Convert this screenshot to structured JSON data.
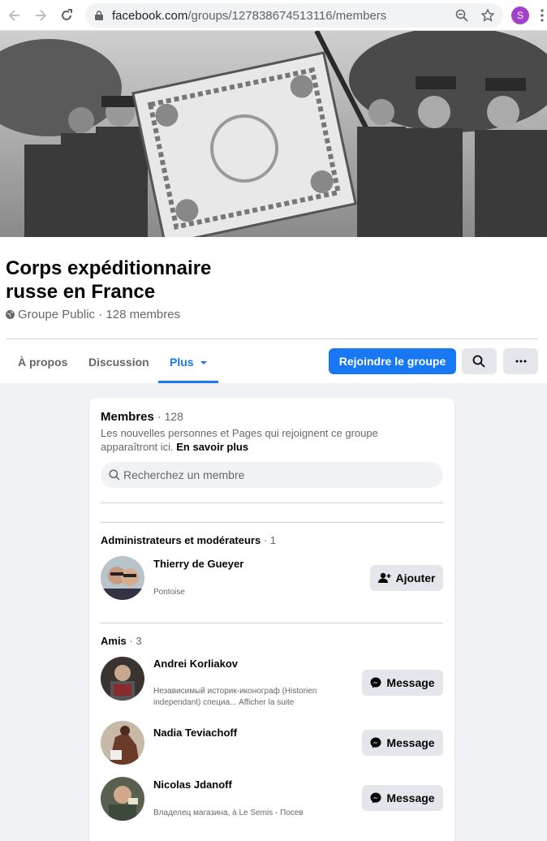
{
  "browser": {
    "url_host": "facebook.com",
    "url_path": "/groups/127838674513116/members",
    "profile_initial": "S"
  },
  "group": {
    "title": "Corps expéditionnaire russe en France",
    "meta": "Groupe Public · 128 membres"
  },
  "tabs": {
    "about": "À propos",
    "discussion": "Discussion",
    "more": "Plus",
    "join": "Rejoindre le groupe"
  },
  "members": {
    "title": "Membres",
    "count": "· 128",
    "description": "Les nouvelles personnes et Pages qui rejoignent ce groupe apparaîtront ici.",
    "learn_more": "En savoir plus",
    "search_placeholder": "Recherchez un membre"
  },
  "admins": {
    "title": "Administrateurs et modérateurs",
    "count": "· 1",
    "items": [
      {
        "name": "Thierry de Gueyer",
        "sub": "Pontoise",
        "action": "Ajouter"
      }
    ]
  },
  "friends": {
    "title": "Amis",
    "count": "· 3",
    "items": [
      {
        "name": "Andrei Korliakov",
        "sub": "Независимый историк-иконограф (Historien independant) специа... Afficher la suite",
        "action": "Message"
      },
      {
        "name": "Nadia Teviachoff",
        "sub": "",
        "action": "Message"
      },
      {
        "name": "Nicolas Jdanoff",
        "sub": "Владелец магазина, à Le Semis - Посев",
        "action": "Message"
      }
    ]
  },
  "colors": {
    "accent": "#1877f2",
    "button_gray": "#e4e6eb",
    "page_bg": "#f0f2f5",
    "secondary_text": "#65676b",
    "profile": "#a142c8"
  }
}
